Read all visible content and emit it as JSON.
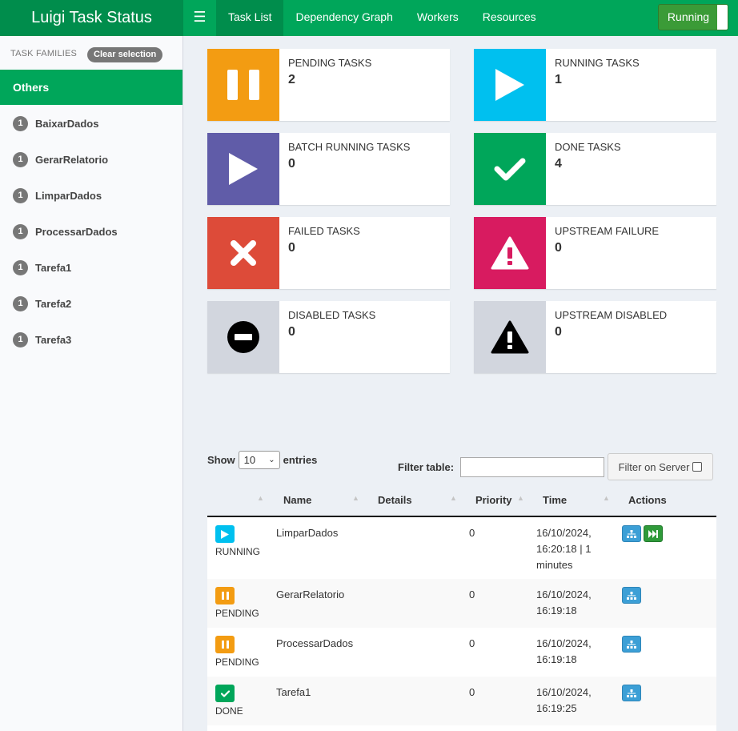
{
  "header": {
    "brand": "Luigi Task Status",
    "nav": [
      "Task List",
      "Dependency Graph",
      "Workers",
      "Resources"
    ],
    "toggle_label": "Running"
  },
  "sidebar": {
    "heading": "TASK FAMILIES",
    "clear_label": "Clear selection",
    "selected": "Others",
    "items": [
      {
        "count": "1",
        "label": "BaixarDados"
      },
      {
        "count": "1",
        "label": "GerarRelatorio"
      },
      {
        "count": "1",
        "label": "LimparDados"
      },
      {
        "count": "1",
        "label": "ProcessarDados"
      },
      {
        "count": "1",
        "label": "Tarefa1"
      },
      {
        "count": "1",
        "label": "Tarefa2"
      },
      {
        "count": "1",
        "label": "Tarefa3"
      }
    ]
  },
  "boxes": {
    "pending": {
      "label": "PENDING TASKS",
      "value": "2",
      "color": "#f39c12"
    },
    "running": {
      "label": "RUNNING TASKS",
      "value": "1",
      "color": "#00c0ef"
    },
    "batch": {
      "label": "BATCH RUNNING TASKS",
      "value": "0",
      "color": "#605ca8"
    },
    "done": {
      "label": "DONE TASKS",
      "value": "4",
      "color": "#00a65a"
    },
    "failed": {
      "label": "FAILED TASKS",
      "value": "0",
      "color": "#dd4b39"
    },
    "upstream_failure": {
      "label": "UPSTREAM FAILURE",
      "value": "0",
      "color": "#d81b60"
    },
    "disabled": {
      "label": "DISABLED TASKS",
      "value": "0",
      "color": "#d2d6de"
    },
    "upstream_disabled": {
      "label": "UPSTREAM DISABLED",
      "value": "0",
      "color": "#d2d6de"
    }
  },
  "table": {
    "show_label": "Show",
    "entries_value": "10",
    "entries_label": "entries",
    "filter_label": "Filter table:",
    "filter_value": "",
    "server_label": "Filter on Server",
    "columns": [
      "Name",
      "Details",
      "Priority",
      "Time",
      "Actions"
    ],
    "rows": [
      {
        "status": "RUNNING",
        "name": "LimparDados",
        "details": "",
        "priority": "0",
        "time1": "16/10/2024,",
        "time2": "16:20:18 | 1",
        "time3": "minutes"
      },
      {
        "status": "PENDING",
        "name": "GerarRelatorio",
        "details": "",
        "priority": "0",
        "time1": "16/10/2024,",
        "time2": "16:19:18",
        "time3": ""
      },
      {
        "status": "PENDING",
        "name": "ProcessarDados",
        "details": "",
        "priority": "0",
        "time1": "16/10/2024,",
        "time2": "16:19:18",
        "time3": ""
      },
      {
        "status": "DONE",
        "name": "Tarefa1",
        "details": "",
        "priority": "0",
        "time1": "16/10/2024,",
        "time2": "16:19:25",
        "time3": ""
      }
    ]
  }
}
